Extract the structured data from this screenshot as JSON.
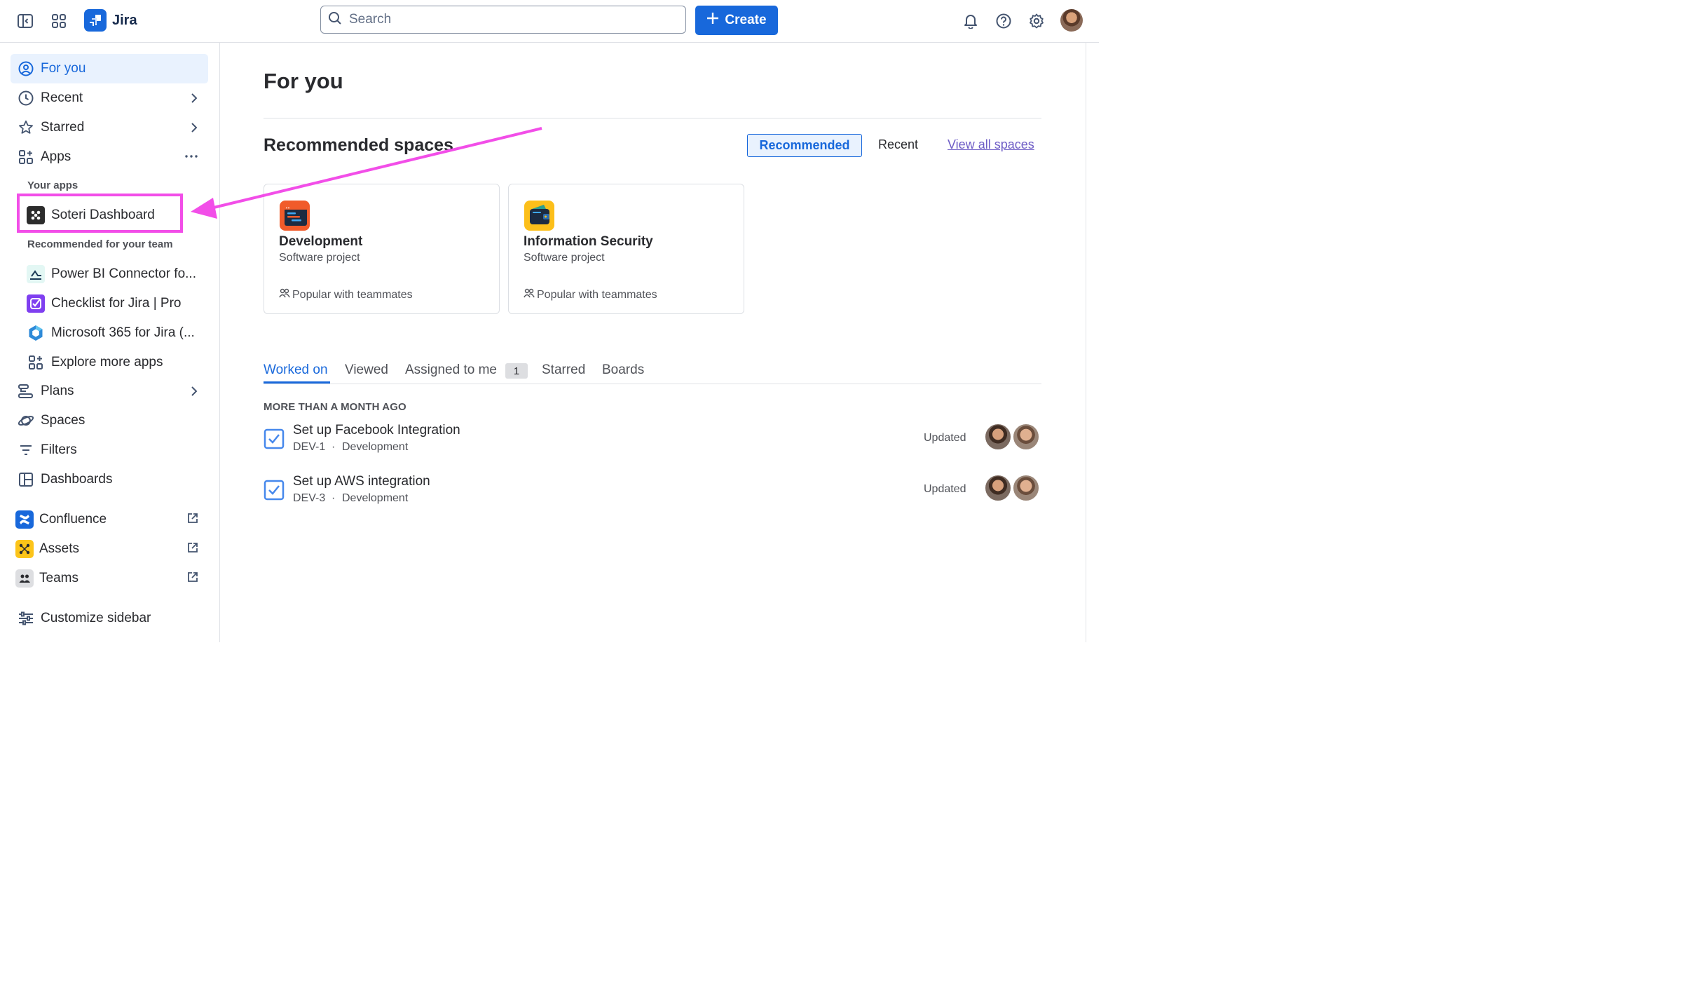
{
  "topbar": {
    "app_name": "Jira",
    "search_placeholder": "Search",
    "create_label": "Create"
  },
  "sidebar": {
    "for_you": "For you",
    "recent": "Recent",
    "starred": "Starred",
    "apps": "Apps",
    "your_apps_label": "Your apps",
    "your_apps": [
      "Soteri Dashboard"
    ],
    "recommended_label": "Recommended for your team",
    "recommended_apps": [
      "Power BI Connector fo...",
      "Checklist for Jira | Pro",
      "Microsoft 365 for Jira (...",
      "Explore more apps"
    ],
    "plans": "Plans",
    "spaces": "Spaces",
    "filters": "Filters",
    "dashboards": "Dashboards",
    "confluence": "Confluence",
    "assets": "Assets",
    "teams": "Teams",
    "customize": "Customize sidebar"
  },
  "main": {
    "title": "For you",
    "recommended_title": "Recommended spaces",
    "segment_recommended": "Recommended",
    "segment_recent": "Recent",
    "view_all": "View all spaces",
    "cards": [
      {
        "name": "Development",
        "type": "Software project",
        "popular": "Popular with teammates"
      },
      {
        "name": "Information Security",
        "type": "Software project",
        "popular": "Popular with teammates"
      }
    ],
    "tabs": [
      "Worked on",
      "Viewed",
      "Assigned to me",
      "Starred",
      "Boards"
    ],
    "assigned_count": "1",
    "group_label": "MORE THAN A MONTH AGO",
    "items": [
      {
        "title": "Set up Facebook Integration",
        "key": "DEV-1",
        "sep": "·",
        "project": "Development",
        "status": "Updated"
      },
      {
        "title": "Set up AWS integration",
        "key": "DEV-3",
        "sep": "·",
        "project": "Development",
        "status": "Updated"
      }
    ]
  },
  "annotation": {
    "color": "#f24ee8"
  }
}
